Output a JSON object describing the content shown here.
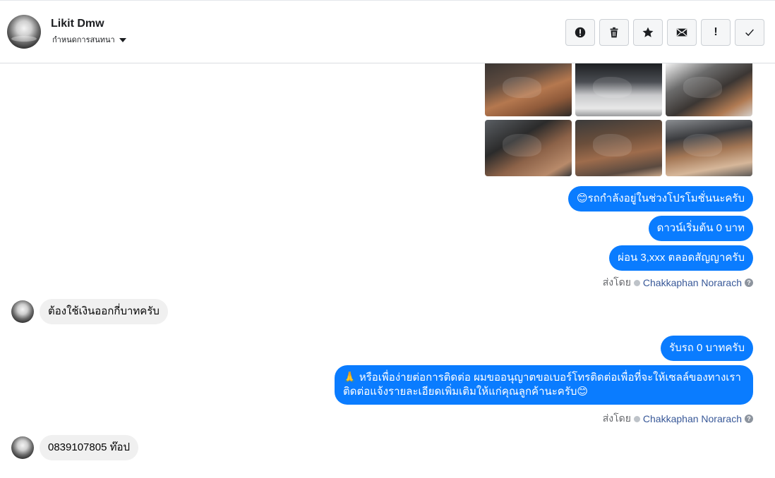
{
  "header": {
    "contact_name": "Likit Dmw",
    "assign_label": "กำหนดการสนทนา"
  },
  "toolbar": {
    "buttons": [
      {
        "name": "spam",
        "icon": "alert-circle-icon"
      },
      {
        "name": "delete",
        "icon": "trash-icon"
      },
      {
        "name": "star",
        "icon": "star-icon"
      },
      {
        "name": "unread",
        "icon": "envelope-icon"
      },
      {
        "name": "follow-up",
        "icon": "exclamation-icon",
        "glyph": "!"
      },
      {
        "name": "done",
        "icon": "checkmark-icon"
      }
    ]
  },
  "photos": [
    {
      "desc": "car-interior-dashboard"
    },
    {
      "desc": "engine-bay"
    },
    {
      "desc": "steering-wheel"
    },
    {
      "desc": "front-seats"
    },
    {
      "desc": "gear-shifter"
    },
    {
      "desc": "rear-seats"
    }
  ],
  "messages": {
    "out1": "😊รถกำลังอยู่ในช่วงโปรโมชั่นนะครับ",
    "out2": "ดาวน์เริ่มต้น 0 บาท",
    "out3": "ผ่อน 3,xxx ตลอดสัญญาครับ",
    "sent_by_label": "ส่งโดย",
    "agent_name": "Chakkaphan Norarach",
    "in1": "ต้องใช้เงินออกกี่บาทครับ",
    "out4": "รับรถ 0 บาทครับ",
    "out5": "🙏 หรือเพื่อง่ายต่อการติดต่อ ผมขออนุญาตขอเบอร์โทรติดต่อเพื่อที่จะให้เซลล์ของทางเราติดต่อแจ้งรายละเอียดเพิ่มเติมให้แก่คุณลูกค้านะครับ😊",
    "in2": "0839107805 ท๊อป"
  },
  "colors": {
    "outgoing_bubble": "#0a7cff",
    "incoming_bubble": "#f0f0f0",
    "agent_link": "#385898"
  }
}
